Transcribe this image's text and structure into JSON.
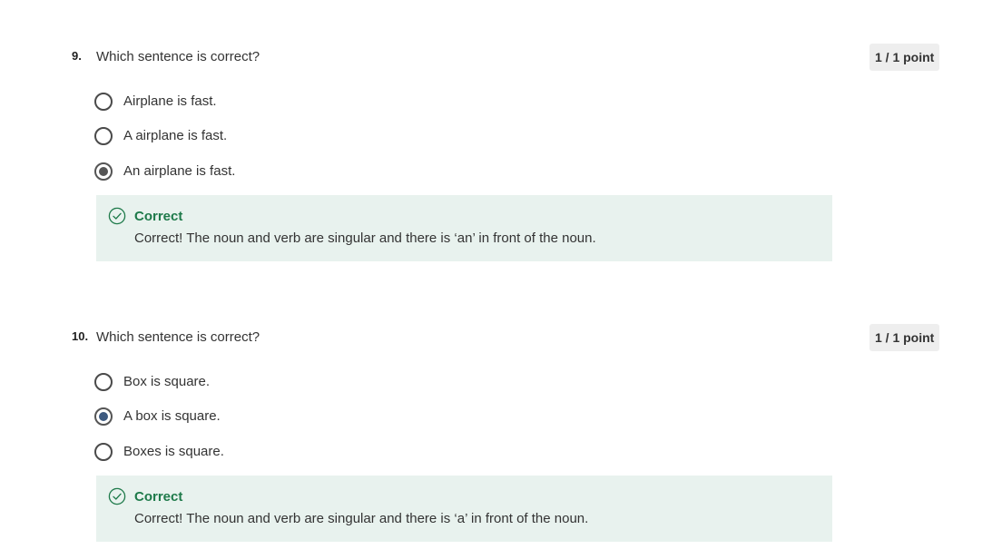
{
  "questions": [
    {
      "number": "9.",
      "text": "Which sentence is correct?",
      "points": "1 / 1 point",
      "options": [
        {
          "label": "Airplane is fast.",
          "selected": false
        },
        {
          "label": "A airplane is fast.",
          "selected": false
        },
        {
          "label": "An airplane is fast.",
          "selected": true
        }
      ],
      "feedback": {
        "title": "Correct",
        "text": "Correct! The noun and verb are singular and there is ‘an’ in front of the noun."
      }
    },
    {
      "number": "10.",
      "text": "Which sentence is correct?",
      "points": "1 / 1 point",
      "options": [
        {
          "label": "Box is square.",
          "selected": false
        },
        {
          "label": "A box is square.",
          "selected": true
        },
        {
          "label": "Boxes is square.",
          "selected": false
        }
      ],
      "feedback": {
        "title": "Correct",
        "text": "Correct! The noun and verb are singular and there is ‘a’ in front of the noun."
      }
    }
  ],
  "colors": {
    "feedback_bg": "#e8f2ee",
    "correct_green": "#1e7a4a",
    "badge_bg": "#eeeeee",
    "radio_selected": "#555555",
    "radio_selected_q10": "#3d5a80"
  },
  "icons": {
    "feedback": "check-circle-icon",
    "option": "radio-button"
  }
}
